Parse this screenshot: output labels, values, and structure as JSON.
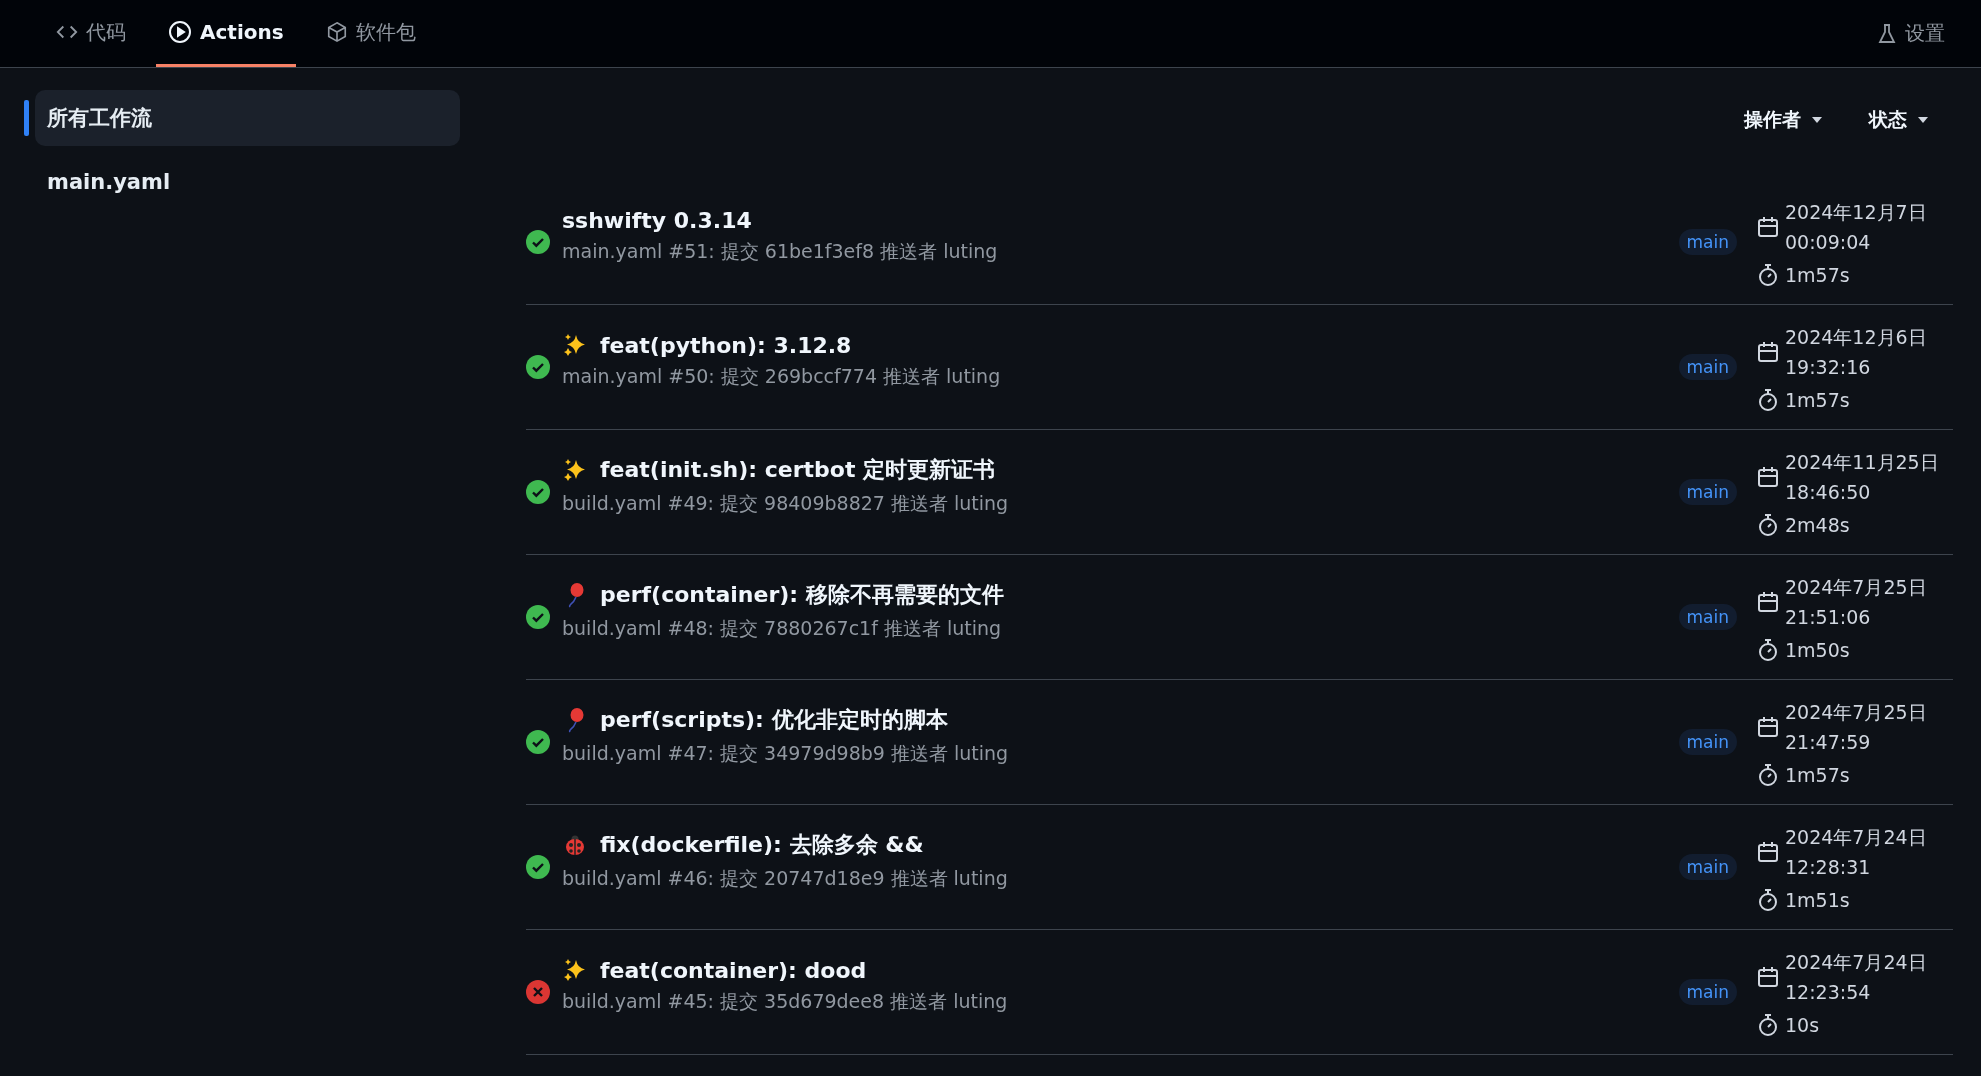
{
  "nav": {
    "tabs": [
      {
        "label": "代码",
        "kind": "code",
        "selected": false
      },
      {
        "label": "Actions",
        "kind": "play",
        "selected": true
      },
      {
        "label": "软件包",
        "kind": "package",
        "selected": false
      }
    ],
    "settings": "设置"
  },
  "sidebar": {
    "items": [
      {
        "label": "所有工作流",
        "selected": true
      },
      {
        "label": "main.yaml",
        "selected": false
      }
    ]
  },
  "filters": [
    "操作者",
    "状态"
  ],
  "runs": [
    {
      "failed": false,
      "kind": "none",
      "title": "sshwifty 0.3.14",
      "detail": "main.yaml #51: 提交 61be1f3ef8 推送者 luting",
      "branch": "main",
      "date": "2024年12月7日",
      "time": "00:09:04",
      "duration": "1m57s"
    },
    {
      "failed": false,
      "kind": "sparkles",
      "title": "feat(python): 3.12.8",
      "detail": "main.yaml #50: 提交 269bccf774 推送者 luting",
      "branch": "main",
      "date": "2024年12月6日",
      "time": "19:32:16",
      "duration": "1m57s"
    },
    {
      "failed": false,
      "kind": "sparkles",
      "title": "feat(init.sh): certbot 定时更新证书",
      "detail": "build.yaml #49: 提交 98409b8827 推送者 luting",
      "branch": "main",
      "date": "2024年11月25日",
      "time": "18:46:50",
      "duration": "2m48s"
    },
    {
      "failed": false,
      "kind": "balloon",
      "title": "perf(container): 移除不再需要的文件",
      "detail": "build.yaml #48: 提交 7880267c1f 推送者 luting",
      "branch": "main",
      "date": "2024年7月25日",
      "time": "21:51:06",
      "duration": "1m50s"
    },
    {
      "failed": false,
      "kind": "balloon",
      "title": "perf(scripts): 优化非定时的脚本",
      "detail": "build.yaml #47: 提交 34979d98b9 推送者 luting",
      "branch": "main",
      "date": "2024年7月25日",
      "time": "21:47:59",
      "duration": "1m57s"
    },
    {
      "failed": false,
      "kind": "ladybug",
      "title": "fix(dockerfile): 去除多余 &&",
      "detail": "build.yaml #46: 提交 20747d18e9 推送者 luting",
      "branch": "main",
      "date": "2024年7月24日",
      "time": "12:28:31",
      "duration": "1m51s"
    },
    {
      "failed": true,
      "kind": "sparkles",
      "title": "feat(container): dood",
      "detail": "build.yaml #45: 提交 35d679dee8 推送者 luting",
      "branch": "main",
      "date": "2024年7月24日",
      "time": "12:23:54",
      "duration": "10s"
    }
  ]
}
